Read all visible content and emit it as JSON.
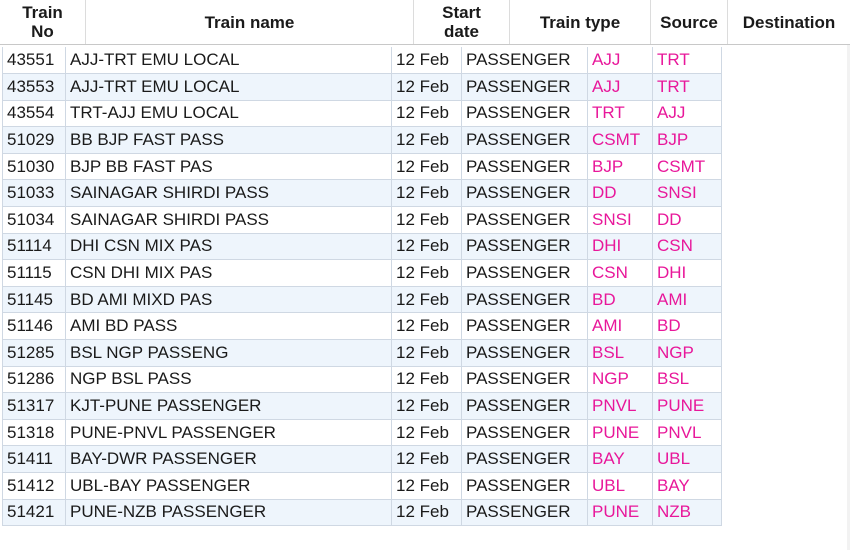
{
  "headers": {
    "train_no": [
      "Train",
      "No"
    ],
    "train_name": "Train name",
    "start_date": [
      "Start",
      "date"
    ],
    "train_type": "Train type",
    "source": "Source",
    "destination": "Destination"
  },
  "colors": {
    "code_text": "#e8179a",
    "alt_row": "#eef5fc",
    "grid_line": "#cfd8e3"
  },
  "rows": [
    {
      "no": "43551",
      "name": "AJJ-TRT EMU LOCAL",
      "date": "12 Feb",
      "type": "PASSENGER",
      "src": "AJJ",
      "dst": "TRT"
    },
    {
      "no": "43553",
      "name": "AJJ-TRT EMU LOCAL",
      "date": "12 Feb",
      "type": "PASSENGER",
      "src": "AJJ",
      "dst": "TRT"
    },
    {
      "no": "43554",
      "name": "TRT-AJJ EMU LOCAL",
      "date": "12 Feb",
      "type": "PASSENGER",
      "src": "TRT",
      "dst": "AJJ"
    },
    {
      "no": "51029",
      "name": "BB BJP FAST PASS",
      "date": "12 Feb",
      "type": "PASSENGER",
      "src": "CSMT",
      "dst": "BJP"
    },
    {
      "no": "51030",
      "name": "BJP BB FAST PAS",
      "date": "12 Feb",
      "type": "PASSENGER",
      "src": "BJP",
      "dst": "CSMT"
    },
    {
      "no": "51033",
      "name": "SAINAGAR SHIRDI PASS",
      "date": "12 Feb",
      "type": "PASSENGER",
      "src": "DD",
      "dst": "SNSI"
    },
    {
      "no": "51034",
      "name": "SAINAGAR SHIRDI PASS",
      "date": "12 Feb",
      "type": "PASSENGER",
      "src": "SNSI",
      "dst": "DD"
    },
    {
      "no": "51114",
      "name": "DHI CSN MIX PAS",
      "date": "12 Feb",
      "type": "PASSENGER",
      "src": "DHI",
      "dst": "CSN"
    },
    {
      "no": "51115",
      "name": "CSN DHI MIX PAS",
      "date": "12 Feb",
      "type": "PASSENGER",
      "src": "CSN",
      "dst": "DHI"
    },
    {
      "no": "51145",
      "name": "BD AMI MIXD PAS",
      "date": "12 Feb",
      "type": "PASSENGER",
      "src": "BD",
      "dst": "AMI"
    },
    {
      "no": "51146",
      "name": "AMI BD PASS",
      "date": "12 Feb",
      "type": "PASSENGER",
      "src": "AMI",
      "dst": "BD"
    },
    {
      "no": "51285",
      "name": "BSL NGP PASSENG",
      "date": "12 Feb",
      "type": "PASSENGER",
      "src": "BSL",
      "dst": "NGP"
    },
    {
      "no": "51286",
      "name": "NGP BSL PASS",
      "date": "12 Feb",
      "type": "PASSENGER",
      "src": "NGP",
      "dst": "BSL"
    },
    {
      "no": "51317",
      "name": "KJT-PUNE PASSENGER",
      "date": "12 Feb",
      "type": "PASSENGER",
      "src": "PNVL",
      "dst": "PUNE"
    },
    {
      "no": "51318",
      "name": "PUNE-PNVL PASSENGER",
      "date": "12 Feb",
      "type": "PASSENGER",
      "src": "PUNE",
      "dst": "PNVL"
    },
    {
      "no": "51411",
      "name": "BAY-DWR PASSENGER",
      "date": "12 Feb",
      "type": "PASSENGER",
      "src": "BAY",
      "dst": "UBL"
    },
    {
      "no": "51412",
      "name": "UBL-BAY PASSENGER",
      "date": "12 Feb",
      "type": "PASSENGER",
      "src": "UBL",
      "dst": "BAY"
    },
    {
      "no": "51421",
      "name": "PUNE-NZB PASSENGER",
      "date": "12 Feb",
      "type": "PASSENGER",
      "src": "PUNE",
      "dst": "NZB"
    }
  ]
}
